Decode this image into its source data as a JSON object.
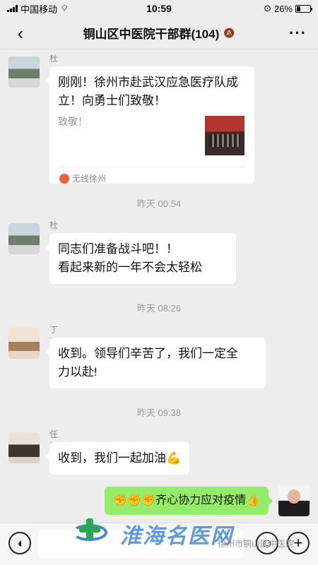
{
  "status_bar": {
    "carrier": "中国移动",
    "time": "10:59",
    "battery": "26%"
  },
  "header": {
    "title": "铜山区中医院干部群(104)"
  },
  "messages": [
    {
      "sender": "杜兵",
      "card_title": "刚刚！徐州市赴武汉应急医疗队成立！向勇士们致敬！",
      "card_desc": "致敬！",
      "card_source": "无线徐州"
    },
    {
      "sender": "杜兵",
      "text_line1": "同志们准备战斗吧！！",
      "text_line2": "看起来新的一年不会太轻松"
    },
    {
      "sender": "丁莉",
      "text_line1": "收到。领导们辛苦了，我们一定全",
      "text_line2": "力以赴!"
    },
    {
      "sender": "任翠",
      "text": "收到，我们一起加油💪"
    }
  ],
  "timestamps": [
    "昨天 00:54",
    "昨天 08:26",
    "昨天 09:38"
  ],
  "own_message": {
    "text": "✊✊✊齐心协力应对疫情👍"
  },
  "watermark": {
    "text": "淮海名医网",
    "source": "徐州市铜山区中医院"
  },
  "icons": [
    "back-icon",
    "mute-icon",
    "more-icon",
    "voice-icon",
    "emoji-icon",
    "plus-icon"
  ]
}
